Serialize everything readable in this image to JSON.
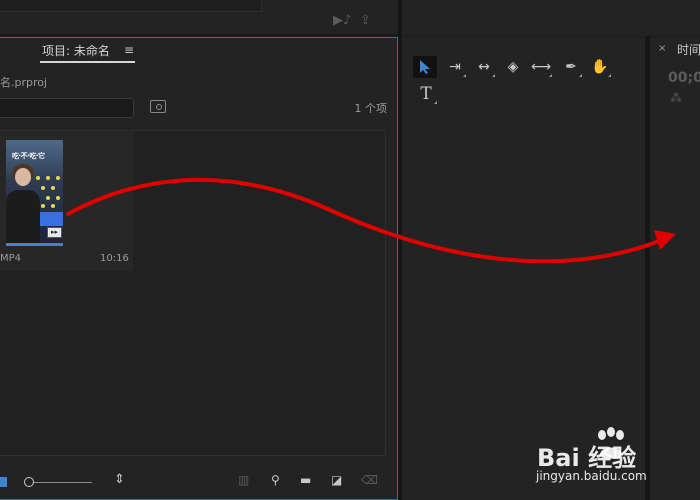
{
  "project_panel": {
    "tab_title": "项目: 未命名",
    "menu_icon": "hamburger-menu-icon",
    "file_name": "名.prproj",
    "item_count": "1 个项",
    "search_placeholder": "",
    "clip": {
      "name": "MP4",
      "duration": "10:16",
      "thumbnail_caption": "吃·不·吃·它"
    },
    "bottom_icons": [
      "list-view-icon",
      "zoom-slider",
      "sort-icon",
      "automate-icon",
      "find-icon",
      "new-bin-icon",
      "new-item-icon",
      "delete-icon"
    ]
  },
  "tools_panel": {
    "tools": [
      "selection-tool",
      "track-select-tool",
      "ripple-edit-tool",
      "razor-tool",
      "slip-tool",
      "pen-tool",
      "hand-tool",
      "type-tool"
    ],
    "active_tool": "selection-tool",
    "type_glyph": "T"
  },
  "timeline_panel": {
    "close_glyph": "×",
    "title": "时间",
    "timecode": "00;0",
    "snap_glyph": "⁂"
  },
  "watermark": {
    "logo_text": "Bai  经验",
    "url": "jingyan.baidu.com"
  },
  "colors": {
    "accent": "#3b84d6",
    "arrow": "#e00000",
    "panel_bg": "#232323",
    "panel_border_active": "#2a6bd6"
  }
}
